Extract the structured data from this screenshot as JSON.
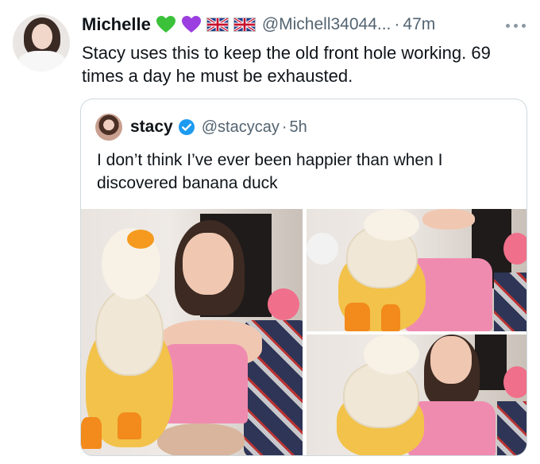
{
  "tweet": {
    "display_name": "Michelle",
    "handle": "@Michell34044...",
    "separator": "·",
    "time": "47m",
    "text": "Stacy uses this to keep the old front hole working. 69 times a day  he must be exhausted.",
    "badges": [
      "green-heart-icon",
      "purple-heart-icon",
      "uk-flag-icon",
      "uk-flag-icon"
    ]
  },
  "quote": {
    "display_name": "stacy",
    "handle": "@stacycay",
    "separator": "·",
    "time": "5h",
    "text": "I don’t think I’ve ever been happier than when I discovered banana duck",
    "media_count": 3
  },
  "colors": {
    "text_primary": "#0f1419",
    "text_secondary": "#536471",
    "border": "#cfd9de",
    "verified_blue": "#1d9bf0",
    "green_heart": "#3cc13b",
    "purple_heart": "#9b3fe0"
  }
}
